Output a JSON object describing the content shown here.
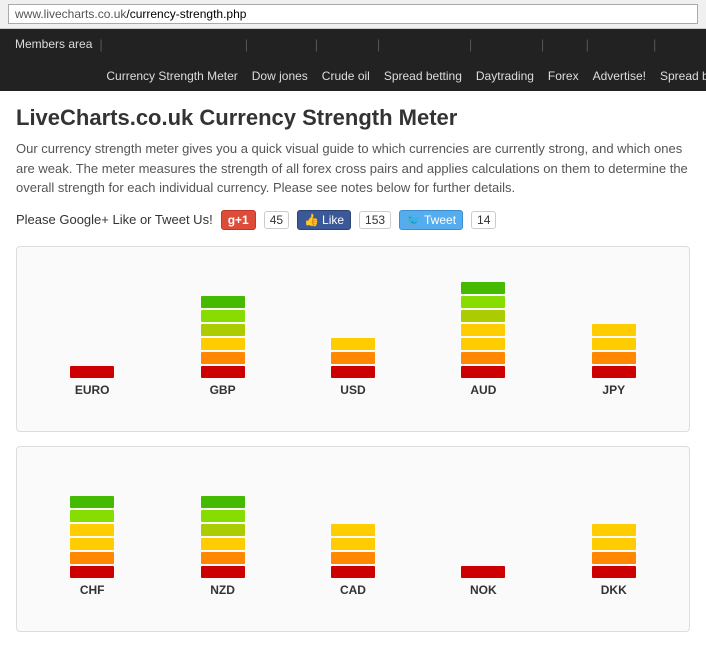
{
  "browser": {
    "url_base": "www.livecharts.co.uk",
    "url_path": "/currency-strength.php"
  },
  "nav": {
    "items": [
      {
        "label": "Members area",
        "href": "#"
      },
      {
        "label": "Currency Strength Meter",
        "href": "#"
      },
      {
        "label": "Dow jones",
        "href": "#"
      },
      {
        "label": "Crude oil",
        "href": "#"
      },
      {
        "label": "Spread betting",
        "href": "#"
      },
      {
        "label": "Daytrading",
        "href": "#"
      },
      {
        "label": "Forex",
        "href": "#"
      },
      {
        "label": "Advertise!",
        "href": "#"
      },
      {
        "label": "Spread betting demo",
        "href": "#"
      }
    ]
  },
  "page": {
    "title": "LiveCharts.co.uk Currency Strength Meter",
    "description": "Our currency strength meter gives you a quick visual guide to which currencies are currently strong, and which ones are weak. The meter measures the strength of all forex cross pairs and applies calculations on them to determine the overall strength for each individual currency. Please see notes below for further details."
  },
  "social": {
    "prompt": "Please Google+ Like or Tweet Us!",
    "gplus_label": "g+1",
    "gplus_count": "45",
    "fb_label": "Like",
    "fb_count": "153",
    "tweet_label": "Tweet",
    "tweet_count": "14"
  },
  "chart1": {
    "currencies": [
      {
        "label": "EURO",
        "bars": [
          "red"
        ]
      },
      {
        "label": "GBP",
        "bars": [
          "green",
          "light-green",
          "yellow-green",
          "yellow",
          "orange",
          "red"
        ]
      },
      {
        "label": "USD",
        "bars": [
          "yellow",
          "orange",
          "red"
        ]
      },
      {
        "label": "AUD",
        "bars": [
          "green",
          "light-green",
          "yellow-green",
          "yellow",
          "yellow",
          "orange",
          "red"
        ]
      },
      {
        "label": "JPY",
        "bars": [
          "yellow",
          "yellow",
          "orange",
          "red"
        ]
      }
    ]
  },
  "chart2": {
    "currencies": [
      {
        "label": "CHF",
        "bars": [
          "green",
          "light-green",
          "yellow",
          "yellow",
          "orange",
          "red"
        ]
      },
      {
        "label": "NZD",
        "bars": [
          "green",
          "light-green",
          "yellow-green",
          "yellow",
          "orange",
          "red"
        ]
      },
      {
        "label": "CAD",
        "bars": [
          "yellow",
          "yellow",
          "orange",
          "red"
        ]
      },
      {
        "label": "NOK",
        "bars": [
          "red"
        ]
      },
      {
        "label": "DKK",
        "bars": [
          "yellow",
          "yellow",
          "orange",
          "red"
        ]
      }
    ]
  }
}
